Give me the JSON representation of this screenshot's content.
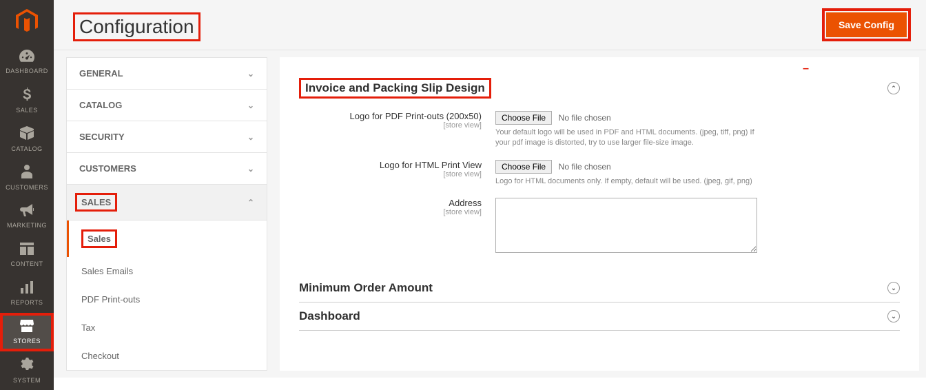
{
  "nav": [
    {
      "icon": "dashboard",
      "label": "DASHBOARD"
    },
    {
      "icon": "sales",
      "label": "SALES"
    },
    {
      "icon": "catalog",
      "label": "CATALOG"
    },
    {
      "icon": "customers",
      "label": "CUSTOMERS"
    },
    {
      "icon": "marketing",
      "label": "MARKETING"
    },
    {
      "icon": "content",
      "label": "CONTENT"
    },
    {
      "icon": "reports",
      "label": "REPORTS"
    },
    {
      "icon": "stores",
      "label": "STORES",
      "active": true,
      "highlighted": true
    },
    {
      "icon": "system",
      "label": "SYSTEM"
    }
  ],
  "header": {
    "title": "Configuration",
    "save_label": "Save Config"
  },
  "config_nav": {
    "sections": [
      {
        "label": "GENERAL",
        "expanded": false
      },
      {
        "label": "CATALOG",
        "expanded": false
      },
      {
        "label": "SECURITY",
        "expanded": false
      },
      {
        "label": "CUSTOMERS",
        "expanded": false
      },
      {
        "label": "SALES",
        "expanded": true,
        "highlighted": true,
        "items": [
          {
            "label": "Sales",
            "active": true,
            "highlighted": true
          },
          {
            "label": "Sales Emails"
          },
          {
            "label": "PDF Print-outs"
          },
          {
            "label": "Tax"
          },
          {
            "label": "Checkout"
          }
        ]
      }
    ]
  },
  "invoice_design": {
    "title": "Invoice and Packing Slip Design",
    "fields": {
      "logo_pdf": {
        "label": "Logo for PDF Print-outs (200x50)",
        "scope": "[store view]",
        "choose": "Choose File",
        "status": "No file chosen",
        "note": "Your default logo will be used in PDF and HTML documents.\n(jpeg, tiff, png) If your pdf image is distorted, try to use larger file-size image."
      },
      "logo_html": {
        "label": "Logo for HTML Print View",
        "scope": "[store view]",
        "choose": "Choose File",
        "status": "No file chosen",
        "note": "Logo for HTML documents only. If empty, default will be used.\n(jpeg, gif, png)"
      },
      "address": {
        "label": "Address",
        "scope": "[store view]",
        "value": ""
      }
    }
  },
  "collapsed_sections": [
    {
      "title": "Minimum Order Amount"
    },
    {
      "title": "Dashboard"
    }
  ]
}
